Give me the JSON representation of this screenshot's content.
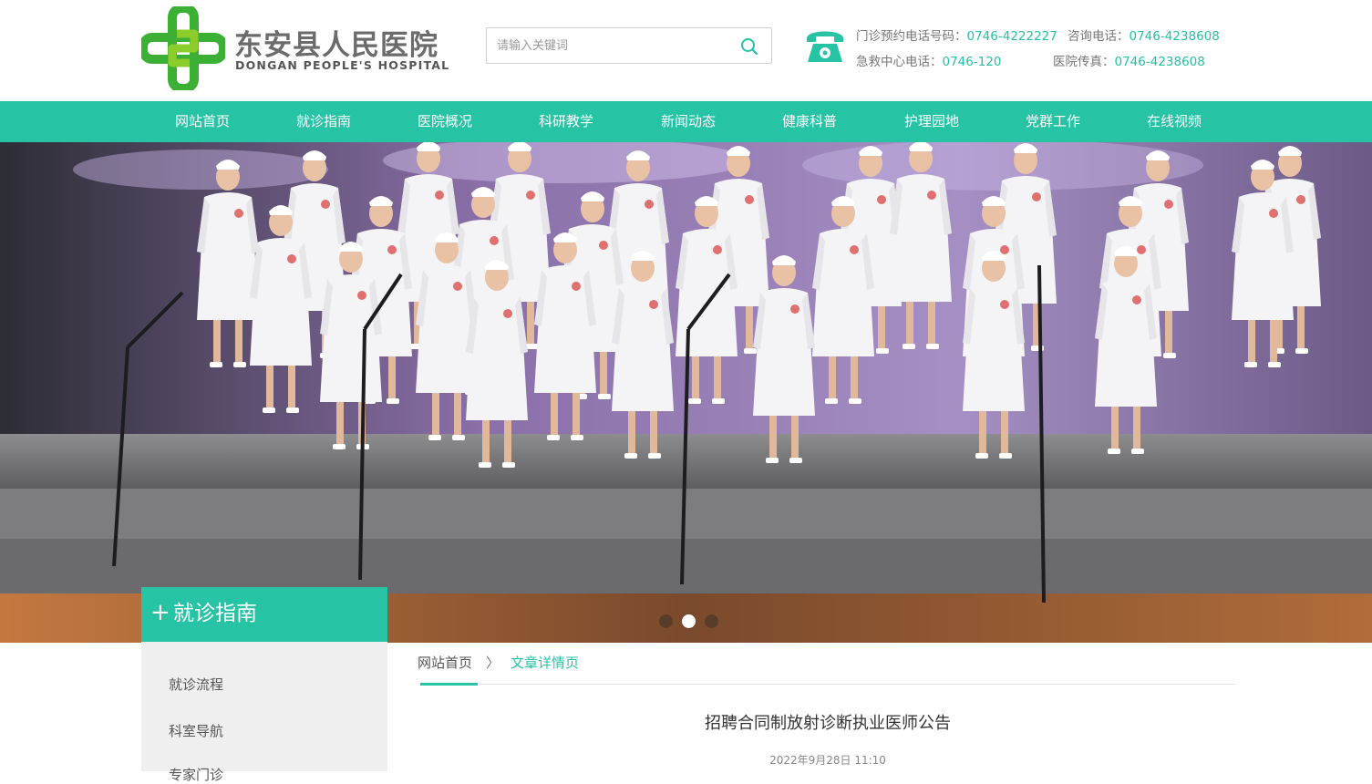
{
  "header": {
    "logo_cn": "东安县人民医院",
    "logo_en": "DONGAN PEOPLE'S HOSPITAL",
    "search_placeholder": "请输入关键词",
    "contacts": [
      {
        "label": "门诊预约电话号码：",
        "value": "0746-4222227"
      },
      {
        "label": "咨询电话：",
        "value": "0746-4238608"
      },
      {
        "label": "急救中心电话：",
        "value": "0746-120"
      },
      {
        "label": "医院传真：",
        "value": "0746-4238608"
      }
    ]
  },
  "nav": {
    "items": [
      {
        "label": "网站首页"
      },
      {
        "label": "就诊指南"
      },
      {
        "label": "医院概况"
      },
      {
        "label": "科研教学"
      },
      {
        "label": "新闻动态"
      },
      {
        "label": "健康科普"
      },
      {
        "label": "护理园地"
      },
      {
        "label": "党群工作"
      },
      {
        "label": "在线视频"
      }
    ]
  },
  "banner": {
    "slide_count": 3,
    "active_slide": 2
  },
  "sidebar": {
    "plus": "+",
    "title": "就诊指南",
    "items": [
      {
        "label": "就诊流程"
      },
      {
        "label": "科室导航"
      },
      {
        "label": "专家门诊"
      }
    ]
  },
  "breadcrumb": {
    "home": "网站首页",
    "separator": "〉",
    "current": "文章详情页"
  },
  "article": {
    "title": "招聘合同制放射诊断执业医师公告",
    "date": "2022年9月28日 11:10"
  },
  "colors": {
    "accent": "#26c3a5",
    "logo_green": "#3cb035",
    "contact_number": "#26bfa2"
  }
}
